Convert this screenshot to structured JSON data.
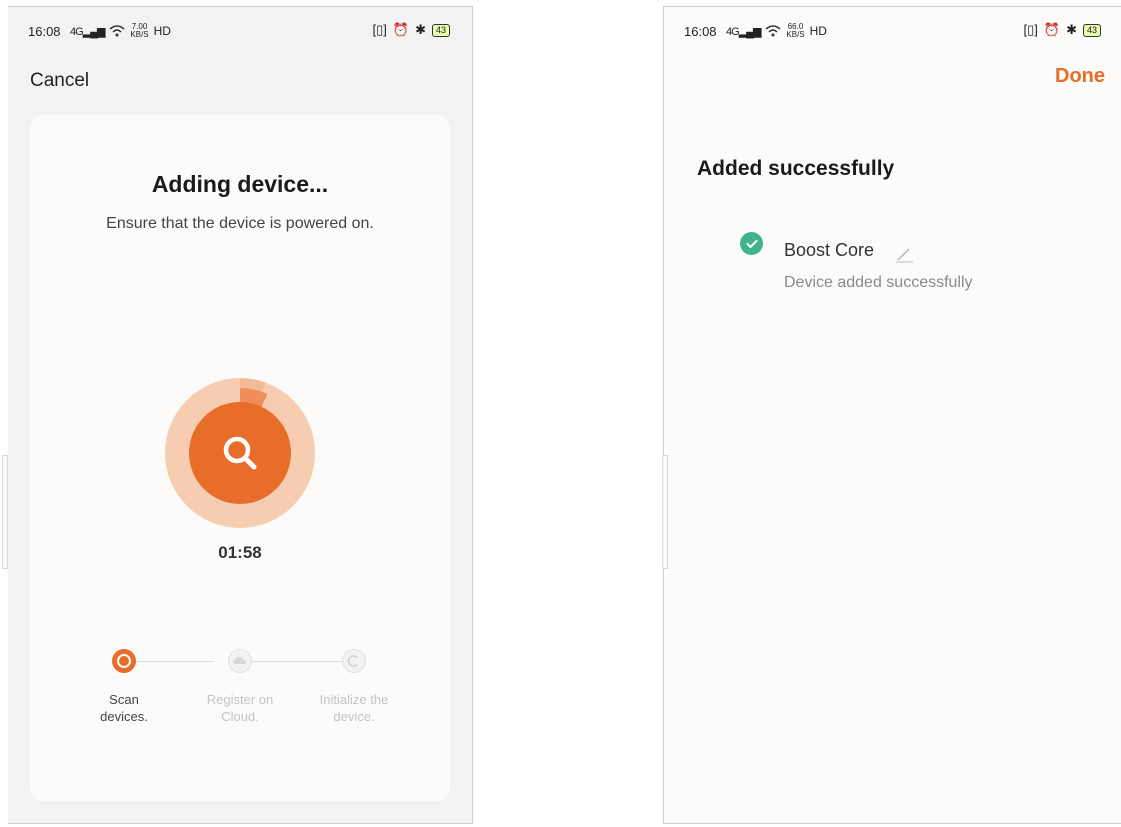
{
  "left_screen": {
    "status_bar": {
      "time": "16:08",
      "network": "4G",
      "speed_value": "7.00",
      "speed_unit": "KB/S",
      "hd": "HD",
      "battery": "43"
    },
    "cancel_label": "Cancel",
    "title": "Adding device...",
    "subtitle": "Ensure that the device is powered on.",
    "timer": "01:58",
    "steps": [
      {
        "label_line1": "Scan",
        "label_line2": "devices.",
        "state": "active"
      },
      {
        "label_line1": "Register on",
        "label_line2": "Cloud.",
        "state": "pending"
      },
      {
        "label_line1": "Initialize the",
        "label_line2": "device.",
        "state": "pending"
      }
    ]
  },
  "right_screen": {
    "status_bar": {
      "time": "16:08",
      "network": "4G",
      "speed_value": "66.0",
      "speed_unit": "KB/S",
      "hd": "HD",
      "battery": "43"
    },
    "done_label": "Done",
    "title": "Added successfully",
    "device": {
      "name": "Boost Core",
      "status": "Device added successfully"
    }
  },
  "colors": {
    "accent": "#e86d2a",
    "success": "#3fb38f"
  },
  "icons": [
    "search-icon",
    "cloud-icon",
    "initialize-icon",
    "check-icon",
    "edit-pencil-icon",
    "vibrate-icon",
    "alarm-icon",
    "bluetooth-icon",
    "wifi-icon",
    "signal-icon",
    "battery-icon"
  ]
}
